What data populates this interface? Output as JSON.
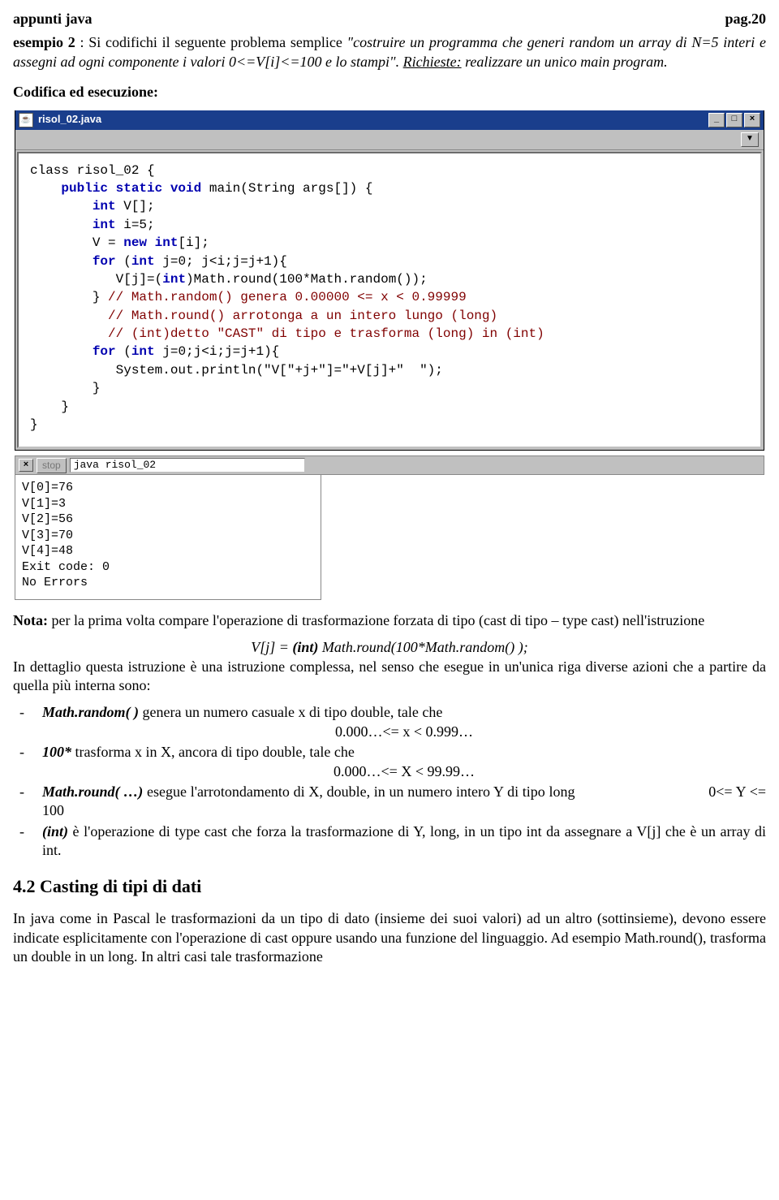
{
  "header": {
    "left": "appunti java",
    "right": "pag.20"
  },
  "intro": {
    "lead_bold": "esempio 2 ",
    "colon": ": Si codifichi il seguente problema semplice ",
    "quote_italic": "\"costruire un programma che generi random un array di N=5 interi e assegni ad ogni componente i valori 0<=V[i]<=100 e lo stampi\". ",
    "rich_label": "Richieste:",
    "rich_rest": " realizzare un unico main program."
  },
  "cod_heading": "Codifica ed esecuzione:",
  "editor_window": {
    "title": "risol_02.java",
    "icon_text": "☕",
    "btn_min": "_",
    "btn_max": "□",
    "btn_close": "×",
    "code_plain_1": "class risol_02 {",
    "code_line2_a": "    public static void",
    "code_line2_b": " main(String args[]) {",
    "code_line3_a": "        int",
    "code_line3_b": " V[];",
    "code_line4_a": "        int",
    "code_line4_b": " i=5;",
    "code_line5_a": "        V = ",
    "code_line5_kw": "new int",
    "code_line5_b": "[i];",
    "code_line6_a": "        for",
    "code_line6_b": " (",
    "code_line6_kw2": "int",
    "code_line6_c": " j=0; j<i;j=j+1){",
    "code_line7_a": "           V[j]=(",
    "code_line7_kw": "int",
    "code_line7_b": ")Math.round(100*Math.random());",
    "code_line8_a": "        } ",
    "code_line8_cm": "// Math.random() genera 0.00000 <= x < 0.99999",
    "code_line9_cm": "          // Math.round() arrotonga a un intero lungo (long)",
    "code_line10_cm": "          // (int)detto \"CAST\" di tipo e trasforma (long) in (int)",
    "code_line11_a": "        for",
    "code_line11_b": " (",
    "code_line11_kw2": "int",
    "code_line11_c": " j=0;j<i;j=j+1){",
    "code_line12": "           System.out.println(\"V[\"+j+\"]=\"+V[j]+\"  \");",
    "code_line13": "        }",
    "code_line14": "    }",
    "code_line15": "}"
  },
  "output_window": {
    "close_x": "×",
    "stop": "stop",
    "cmd": "java risol_02",
    "lines": [
      "V[0]=76",
      "V[1]=3",
      "V[2]=56",
      "V[3]=70",
      "V[4]=48",
      "Exit code: 0",
      "No Errors"
    ]
  },
  "nota": {
    "bold": "Nota:",
    "rest1": " per la prima volta compare l'operazione di trasformazione forzata di tipo (cast di tipo – type cast) nell'istruzione",
    "formula_pre": "V[j] = ",
    "formula_bold": "(int)",
    "formula_post": " Math.round(100*Math.random() );",
    "rest2": "In dettaglio questa istruzione è una istruzione complessa, nel senso che esegue in un'unica riga diverse azioni che a partire da quella più interna sono:"
  },
  "items": {
    "i1_bold": "Math.random( )",
    "i1_rest": " genera un numero casuale x di tipo double, tale che",
    "i1_line": "0.000…<= x < 0.999…",
    "i2_bold": "100*",
    "i2_rest": " trasforma x in X, ancora di tipo double, tale che",
    "i2_line": "0.000…<= X < 99.99…",
    "i3_bold": "Math.round( …)",
    "i3_rest_a": " esegue l'arrotondamento di X, double, in un numero intero Y di tipo long",
    "i3_rest_b": "0<= Y <= 100",
    "i4_bold": "(int)",
    "i4_rest": " è l'operazione di type cast che forza la trasformazione di Y, long, in un tipo int da assegnare a V[j] che è un array di int."
  },
  "section_heading": "4.2 Casting di tipi di dati",
  "last_para": "In java come in Pascal le trasformazioni da un tipo di dato (insieme dei suoi valori) ad un altro (sottinsieme), devono essere indicate esplicitamente con l'operazione di cast oppure usando una funzione del linguaggio. Ad esempio Math.round(), trasforma un double in un long. In altri casi tale trasformazione"
}
